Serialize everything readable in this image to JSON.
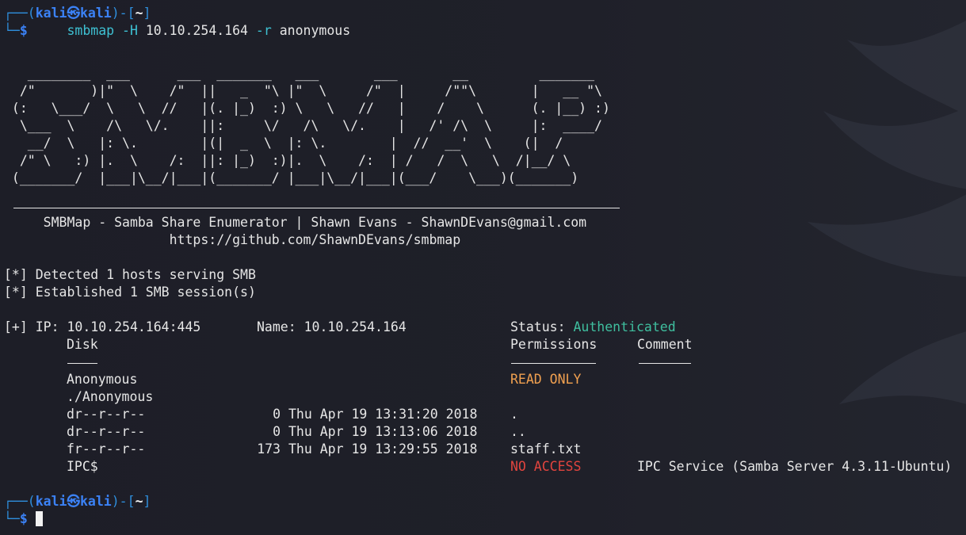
{
  "prompt": {
    "user": "kali",
    "at_symbol": "㉿",
    "host": "kali",
    "dir": "~",
    "dollar": "$"
  },
  "command": {
    "program": "smbmap",
    "flag_h": "-H",
    "ip": "10.10.254.164",
    "flag_r": "-r",
    "share": "anonymous"
  },
  "banner": {
    "ascii_art": "   ________  ___      ___  _______   ___       ___       __         _______\n  /\"       )|\"  \\    /\"  ||   _  \"\\ |\"  \\     /\"  |     /\"\"\\       |   __ \"\\\n (:   \\___/  \\   \\  //   |(. |_)  :) \\   \\   //   |    /    \\      (. |__) :)\n  \\___  \\    /\\   \\/.    ||:     \\/   /\\   \\/.    |   /' /\\  \\     |:  ____/\n   __/  \\   |: \\.        |(|  _  \\  |: \\.        |  //  __'  \\    (|  /\n  /\" \\   :) |.  \\    /:  ||: |_)  :)|.  \\    /:  | /   /  \\   \\  /|__/ \\\n (_______/  |___|\\__/|___|(_______/ |___|\\__/|___|(___/    \\___)(_______)",
    "title": "SMBMap - Samba Share Enumerator | Shawn Evans - ShawnDEvans@gmail.com",
    "url": "https://github.com/ShawnDEvans/smbmap"
  },
  "status_lines": [
    "[*] Detected 1 hosts serving SMB",
    "[*] Established 1 SMB session(s)"
  ],
  "result": {
    "ip_prefix": "[+] IP: 10.10.254.164:445",
    "name": "Name: 10.10.254.164",
    "status_label": "Status: ",
    "status_value": "Authenticated",
    "col_disk": "Disk",
    "col_permissions": "Permissions",
    "col_comment": "Comment",
    "ul_disk": "----",
    "shares": [
      {
        "name": "Anonymous",
        "permission": "READ ONLY",
        "comment": ""
      },
      {
        "name": "IPC$",
        "permission": "NO ACCESS",
        "comment": "IPC Service (Samba Server 4.3.11-Ubuntu)"
      }
    ],
    "listing_path": "./Anonymous",
    "files": [
      {
        "mode": "dr--r--r--",
        "size": "0",
        "date": "Thu Apr 19 13:31:20 2018",
        "name": "."
      },
      {
        "mode": "dr--r--r--",
        "size": "0",
        "date": "Thu Apr 19 13:13:06 2018",
        "name": ".."
      },
      {
        "mode": "fr--r--r--",
        "size": "173",
        "date": "Thu Apr 19 13:29:55 2018",
        "name": "staff.txt"
      }
    ]
  },
  "colors": {
    "background": "#1e1f29",
    "prompt_blue": "#3b82f6",
    "command_cyan": "#3ec1d3",
    "authenticated_green": "#3fbf9f",
    "read_only_orange": "#f0a050",
    "no_access_red": "#e0443e"
  }
}
